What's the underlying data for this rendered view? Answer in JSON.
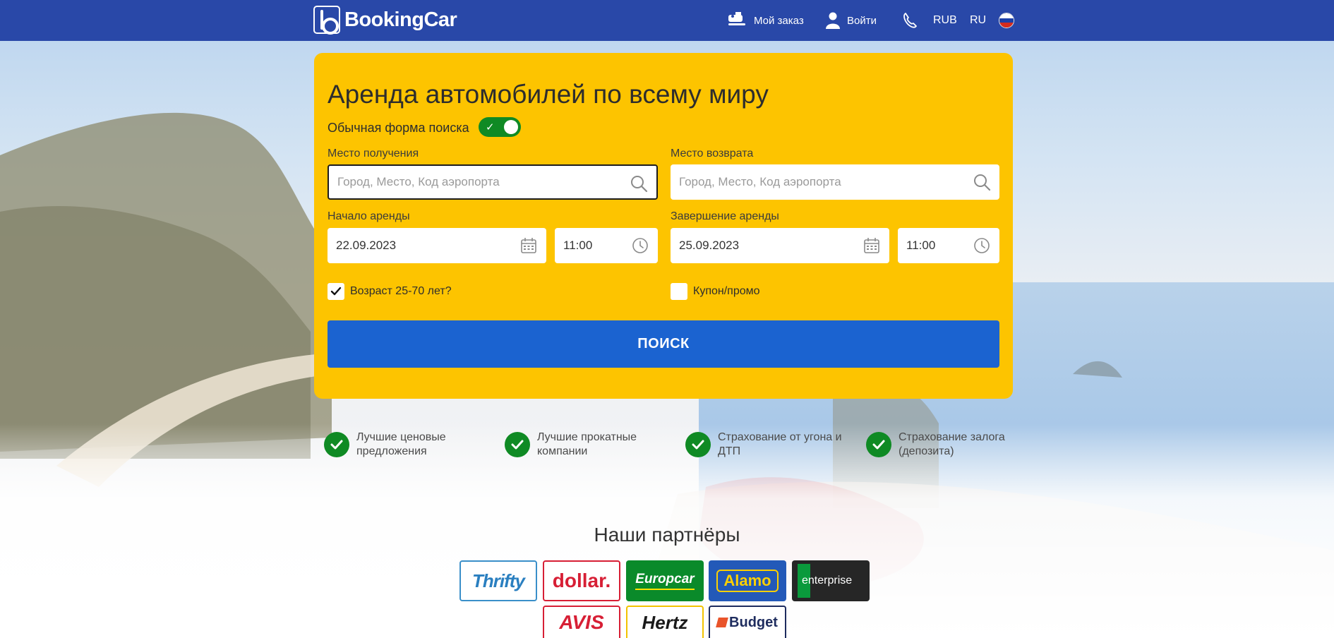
{
  "header": {
    "brand": "BookingCar",
    "my_order": "Мой заказ",
    "login": "Войти",
    "currency": "RUB",
    "language": "RU",
    "colors": {
      "bar": "#2948a8"
    }
  },
  "search": {
    "title": "Аренда автомобилей по всему миру",
    "toggle_label": "Обычная форма поиска",
    "toggle_on": true,
    "pickup_label": "Место получения",
    "pickup_placeholder": "Город, Место, Код аэропорта",
    "return_label": "Место возврата",
    "return_placeholder": "Город, Место, Код аэропорта",
    "start_label": "Начало аренды",
    "start_date": "22.09.2023",
    "start_time": "11:00",
    "end_label": "Завершение аренды",
    "end_date": "25.09.2023",
    "end_time": "11:00",
    "age_label": "Возраст 25-70 лет?",
    "age_checked": true,
    "coupon_label": "Купон/промо",
    "coupon_checked": false,
    "search_button": "ПОИСК",
    "colors": {
      "panel": "#fdc400",
      "button": "#1b63d0",
      "toggle": "#0f8a24"
    }
  },
  "benefits": [
    {
      "line1": "Лучшие ценовые",
      "line2": "предложения"
    },
    {
      "line1": "Лучшие прокатные",
      "line2": "компании"
    },
    {
      "line1": "Страхование от угона и",
      "line2": "ДТП"
    },
    {
      "line1": "Страхование залога",
      "line2": "(депозита)"
    }
  ],
  "partners": {
    "title": "Наши партнёры",
    "logos": [
      "Thrifty",
      "dollar.",
      "Europcar",
      "Alamo",
      "enterprise",
      "AVIS",
      "Hertz",
      "Budget"
    ]
  }
}
